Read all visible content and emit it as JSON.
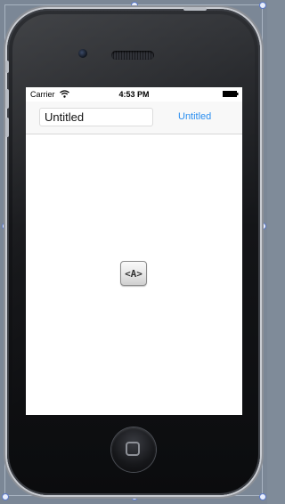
{
  "statusbar": {
    "carrier": "Carrier",
    "time": "4:53 PM",
    "wifi_icon": "wifi-icon",
    "battery_icon": "battery-icon"
  },
  "navbar": {
    "title_field_value": "Untitled",
    "title_button_label": "Untitled"
  },
  "custom_view": {
    "label": "<A>"
  },
  "device": {
    "home_button_icon": "home-button-icon",
    "camera_icon": "camera-icon",
    "speaker_icon": "speaker-icon"
  },
  "colors": {
    "canvas_background": "#7b8796",
    "nav_button_tint": "#2a8ef0",
    "selection_handle": "#5a78c8"
  }
}
